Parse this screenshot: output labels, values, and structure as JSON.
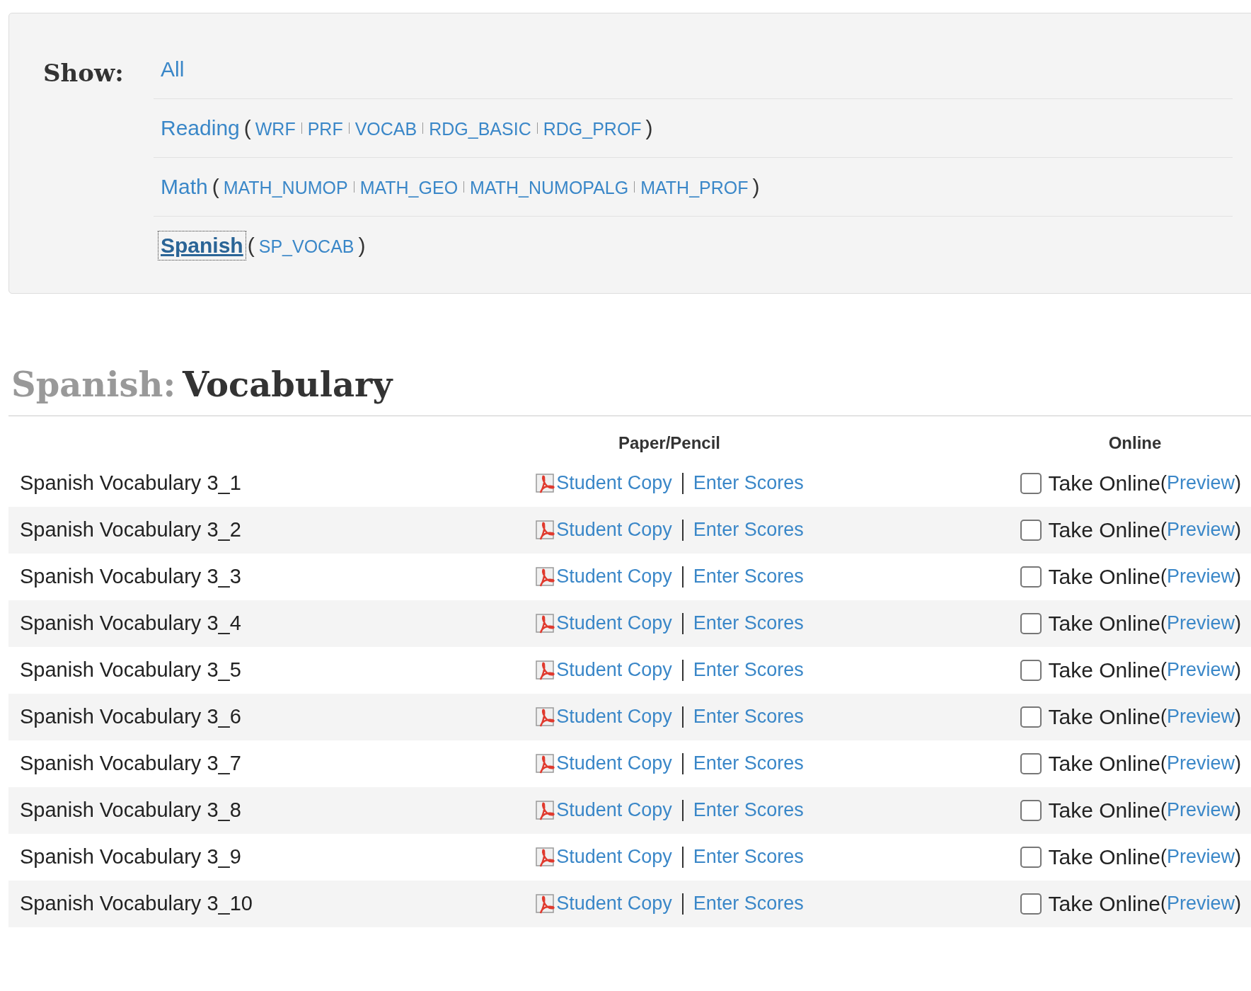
{
  "filter": {
    "label": "Show:",
    "all": {
      "label": "All",
      "selected": false
    },
    "categories": [
      {
        "label": "Reading",
        "selected": false,
        "open": "(",
        "close": ")",
        "codes": [
          "WRF",
          "PRF",
          "VOCAB",
          "RDG_BASIC",
          "RDG_PROF"
        ]
      },
      {
        "label": "Math",
        "selected": false,
        "open": "(",
        "close": ")",
        "codes": [
          "MATH_NUMOP",
          "MATH_GEO",
          "MATH_NUMOPALG",
          "MATH_PROF"
        ]
      },
      {
        "label": "Spanish",
        "selected": true,
        "open": "(",
        "close": ")",
        "codes": [
          "SP_VOCAB"
        ]
      }
    ]
  },
  "heading": {
    "subject": "Spanish:",
    "title": "Vocabulary"
  },
  "table": {
    "columns": [
      "Paper/Pencil",
      "Online"
    ],
    "rows": [
      {
        "name": "Spanish Vocabulary 3_1",
        "student_copy": "Student Copy",
        "enter_scores": "Enter Scores",
        "take_online": "Take Online",
        "checked": false,
        "open": "(",
        "preview": "Preview",
        "close": ")"
      },
      {
        "name": "Spanish Vocabulary 3_2",
        "student_copy": "Student Copy",
        "enter_scores": "Enter Scores",
        "take_online": "Take Online",
        "checked": false,
        "open": "(",
        "preview": "Preview",
        "close": ")"
      },
      {
        "name": "Spanish Vocabulary 3_3",
        "student_copy": "Student Copy",
        "enter_scores": "Enter Scores",
        "take_online": "Take Online",
        "checked": false,
        "open": "(",
        "preview": "Preview",
        "close": ")"
      },
      {
        "name": "Spanish Vocabulary 3_4",
        "student_copy": "Student Copy",
        "enter_scores": "Enter Scores",
        "take_online": "Take Online",
        "checked": false,
        "open": "(",
        "preview": "Preview",
        "close": ")"
      },
      {
        "name": "Spanish Vocabulary 3_5",
        "student_copy": "Student Copy",
        "enter_scores": "Enter Scores",
        "take_online": "Take Online",
        "checked": false,
        "open": "(",
        "preview": "Preview",
        "close": ")"
      },
      {
        "name": "Spanish Vocabulary 3_6",
        "student_copy": "Student Copy",
        "enter_scores": "Enter Scores",
        "take_online": "Take Online",
        "checked": false,
        "open": "(",
        "preview": "Preview",
        "close": ")"
      },
      {
        "name": "Spanish Vocabulary 3_7",
        "student_copy": "Student Copy",
        "enter_scores": "Enter Scores",
        "take_online": "Take Online",
        "checked": false,
        "open": "(",
        "preview": "Preview",
        "close": ")"
      },
      {
        "name": "Spanish Vocabulary 3_8",
        "student_copy": "Student Copy",
        "enter_scores": "Enter Scores",
        "take_online": "Take Online",
        "checked": false,
        "open": "(",
        "preview": "Preview",
        "close": ")"
      },
      {
        "name": "Spanish Vocabulary 3_9",
        "student_copy": "Student Copy",
        "enter_scores": "Enter Scores",
        "take_online": "Take Online",
        "checked": false,
        "open": "(",
        "preview": "Preview",
        "close": ")"
      },
      {
        "name": "Spanish Vocabulary 3_10",
        "student_copy": "Student Copy",
        "enter_scores": "Enter Scores",
        "take_online": "Take Online",
        "checked": false,
        "open": "(",
        "preview": "Preview",
        "close": ")"
      }
    ]
  }
}
